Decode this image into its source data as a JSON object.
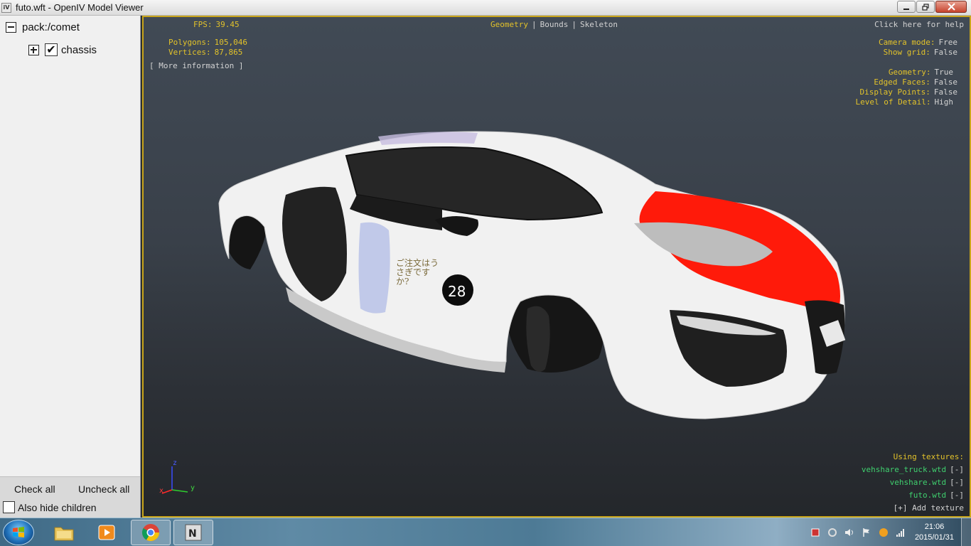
{
  "window": {
    "app_icon": "iV",
    "title": "futo.wft - OpenIV Model Viewer"
  },
  "tree": {
    "root_label": "pack:/comet",
    "child_label": "chassis",
    "child_checked": true
  },
  "panel": {
    "check_all": "Check all",
    "uncheck_all": "Uncheck all",
    "also_hide_children": "Also hide children"
  },
  "viewport": {
    "fps_label": "FPS:",
    "fps_value": "39.45",
    "polygons_label": "Polygons:",
    "polygons_value": "105,046",
    "vertices_label": "Vertices:",
    "vertices_value": "87,865",
    "more_info": "[ More information ]",
    "mode_geometry": "Geometry",
    "mode_bounds": "Bounds",
    "mode_skeleton": "Skeleton",
    "separator": "|",
    "help": "Click here for help",
    "settings": [
      {
        "label": "Camera mode:",
        "value": "Free"
      },
      {
        "label": "Show grid:",
        "value": "False"
      },
      {
        "label": "Geometry:",
        "value": "True"
      },
      {
        "label": "Edged Faces:",
        "value": "False"
      },
      {
        "label": "Display Points:",
        "value": "False"
      },
      {
        "label": "Level of Detail:",
        "value": "High"
      }
    ],
    "textures_heading": "Using textures:",
    "textures": [
      {
        "name": "vehshare_truck.wtd",
        "action": "[-]"
      },
      {
        "name": "vehshare.wtd",
        "action": "[-]"
      },
      {
        "name": "futo.wtd",
        "action": "[-]"
      }
    ],
    "add_texture": "[+] Add texture",
    "axis_z": "z",
    "axis_y": "y",
    "axis_x": "x",
    "car_number": "28",
    "decal_text": "ご注文はうさぎですか?"
  },
  "taskbar": {
    "time": "21:06",
    "date": "2015/01/31"
  },
  "colors": {
    "viewport_border": "#c9a51a",
    "label_yellow": "#e2c22a",
    "value_white": "#d2d2d2",
    "texture_green": "#3fcf6e",
    "car_stripe_red": "#ff1a0a"
  }
}
